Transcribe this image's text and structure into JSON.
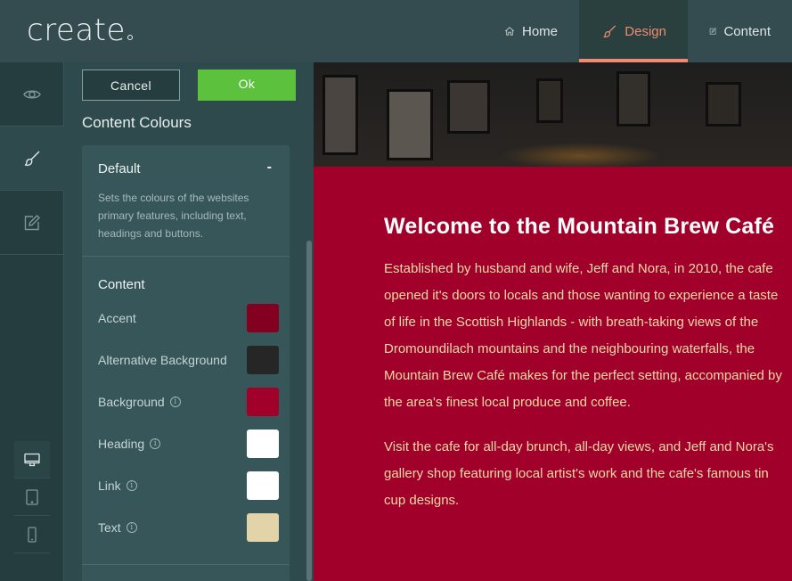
{
  "app": {
    "logo": "create"
  },
  "nav": {
    "home": "Home",
    "design": "Design",
    "content": "Content",
    "active": "design",
    "accent_color": "#f08a72"
  },
  "rail": {
    "items": [
      "preview-icon",
      "brush-icon",
      "edit-icon"
    ],
    "active": "brush-icon",
    "devices": [
      "desktop-icon",
      "tablet-icon",
      "mobile-icon"
    ],
    "active_device": "desktop-icon"
  },
  "panel": {
    "cancel_label": "Cancel",
    "ok_label": "Ok",
    "title": "Content Colours",
    "card": {
      "title": "Default",
      "toggle": "-",
      "description": "Sets the colours of the websites primary features, including text, headings and buttons.",
      "section_title": "Content",
      "swatches": [
        {
          "label": "Accent",
          "color": "#840020",
          "info": false
        },
        {
          "label": "Alternative Background",
          "color": "#262626",
          "info": false
        },
        {
          "label": "Background",
          "color": "#a00029",
          "info": true
        },
        {
          "label": "Heading",
          "color": "#ffffff",
          "info": true
        },
        {
          "label": "Link",
          "color": "#ffffff",
          "info": true
        },
        {
          "label": "Text",
          "color": "#e2d4a8",
          "info": true
        }
      ]
    }
  },
  "preview": {
    "heading": "Welcome to the Mountain Brew Café",
    "paragraph1": "Established by husband and wife, Jeff and Nora, in 2010, the cafe opened it's doors to locals and those wanting to experience a taste of life in the Scottish Highlands - with breath-taking views of the Dromoundilach mountains and the neighbouring waterfalls, the Mountain Brew Café makes for the perfect setting, accompanied by the area's finest local produce and coffee.",
    "paragraph2": "Visit the cafe for all-day brunch, all-day views, and Jeff and Nora's gallery shop featuring local artist's work and the cafe's famous tin cup designs.",
    "background_color": "#a00029"
  }
}
